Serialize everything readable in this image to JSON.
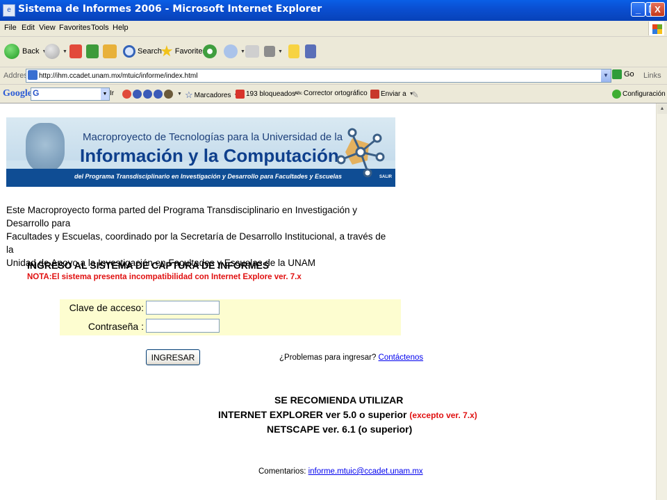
{
  "window": {
    "title": "Sistema de Informes 2006 - Microsoft Internet Explorer",
    "min_label": "_",
    "max_label": "❐",
    "close_label": "X"
  },
  "menu": [
    "File",
    "Edit",
    "View",
    "Favorites",
    "Tools",
    "Help"
  ],
  "toolbar": {
    "back_label": "Back",
    "search_label": "Search",
    "favorites_label": "Favorites"
  },
  "address": {
    "label": "Address",
    "url": "http://ihm.ccadet.unam.mx/mtuic/informe/index.html",
    "go_label": "Go",
    "links_label": "Links"
  },
  "google_bar": {
    "logo": "Google",
    "search_letter": "G",
    "ir_label": "Ir",
    "marcadores_label": "Marcadores",
    "bloqueados_label": "193 bloqueados",
    "corrector_label": "Corrector ortográfico",
    "enviar_label": "Enviar a",
    "config_label": "Configuración"
  },
  "banner": {
    "line1": "Macroproyecto de Tecnologías para la Universidad de la",
    "line2": "Información y la Computación",
    "line3": "del Programa Transdisciplinario en Investigación y Desarrollo para Facultades y Escuelas",
    "salir": "SALIR"
  },
  "intro": {
    "line1": "Este Macroproyecto forma parted del Programa Transdisciplinario en Investigación y Desarrollo para",
    "line2": "Facultades y Escuelas, coordinado por la Secretaría de Desarrollo Institucional, a través de la",
    "line3": "Unidad de Apoyo a la Investigación en Facultades y Escuelas de la UNAM"
  },
  "login": {
    "heading": "INGRESO AL SISTEMA DE CAPTURA DE INFORMES",
    "note": "NOTA:El sistema presenta incompatibilidad con Internet Explore ver. 7.x",
    "key_label": "Clave de acceso:",
    "key_value": "",
    "password_label": "Contraseña :",
    "password_value": "",
    "submit_label": "INGRESAR",
    "problems_text": "¿Problemas para ingresar?",
    "contact_link": "Contáctenos"
  },
  "recommend": {
    "line1": "SE RECOMIENDA UTILIZAR",
    "line2": "INTERNET EXPLORER ver 5.0 o superior",
    "line2_note": "(excepto ver. 7.x)",
    "line3": "NETSCAPE ver. 6.1 (o superior)"
  },
  "comments": {
    "label": "Comentarios:",
    "email": "informe.mtuic@ccadet.unam.mx"
  },
  "colors": {
    "titlebar": "#0a4fd2",
    "chrome": "#ece9d8",
    "note_red": "#e01010",
    "form_panel": "#fdfdd0",
    "banner_band": "#0f4d94",
    "link": "#0000ee"
  }
}
